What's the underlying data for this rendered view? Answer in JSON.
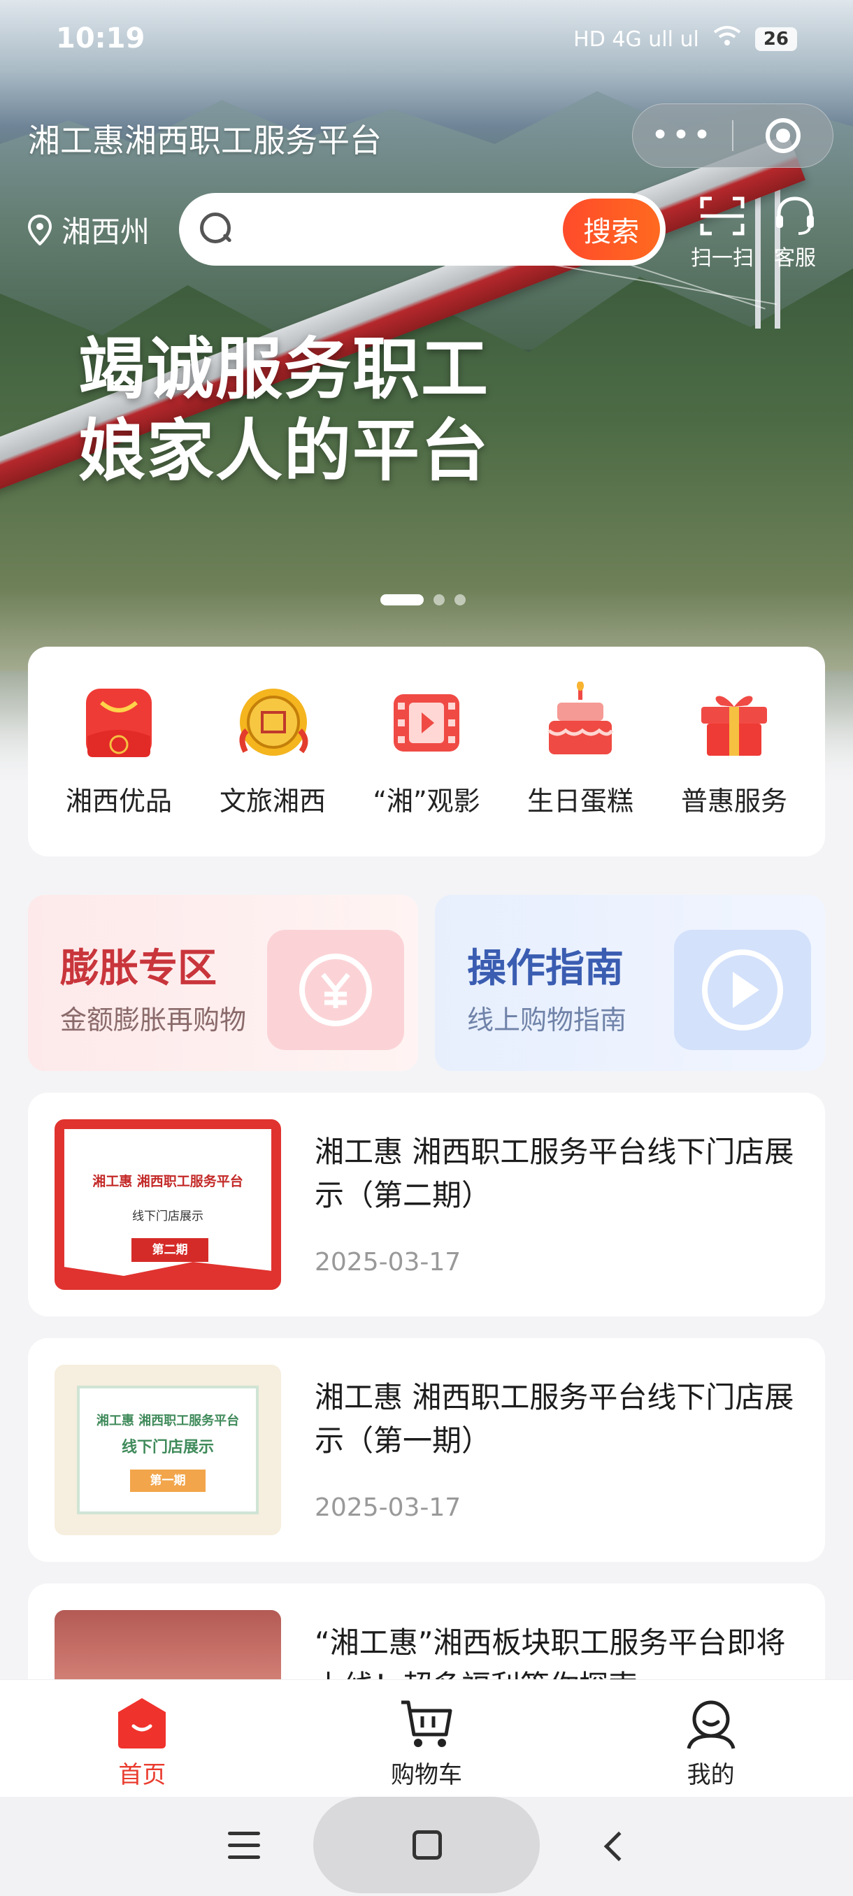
{
  "status_bar": {
    "time": "10:19",
    "signal_text": "HD 4G ull ul",
    "battery": "26"
  },
  "header": {
    "title": "湘工惠湘西职工服务平台",
    "menu_dots": "•••",
    "location": "湘西州",
    "search_placeholder": "",
    "search_button": "搜索",
    "scan_label": "扫一扫",
    "service_label": "客服"
  },
  "banner": {
    "line1": "竭诚服务职工",
    "line2": "娘家人的平台",
    "active_slide": 1,
    "slide_count": 3
  },
  "quick_menu": [
    {
      "label": "湘西优品",
      "icon": "red-bag-icon"
    },
    {
      "label": "文旅湘西",
      "icon": "gold-seal-icon"
    },
    {
      "label": "“湘”观影",
      "icon": "film-icon"
    },
    {
      "label": "生日蛋糕",
      "icon": "cake-icon"
    },
    {
      "label": "普惠服务",
      "icon": "gift-icon"
    }
  ],
  "promos": [
    {
      "title": "膨胀专区",
      "subtitle": "金额膨胀再购物",
      "icon": "yen-cycle-icon"
    },
    {
      "title": "操作指南",
      "subtitle": "线上购物指南",
      "icon": "play-icon"
    }
  ],
  "news": [
    {
      "title": "湘工惠 湘西职工服务平台线下门店展示（第二期）",
      "date": "2025-03-17",
      "thumb_main": "湘工惠 湘西职工服务平台",
      "thumb_sub": "线下门店展示",
      "thumb_tag": "第二期"
    },
    {
      "title": "湘工惠 湘西职工服务平台线下门店展示（第一期）",
      "date": "2025-03-17",
      "thumb_main": "湘工惠 湘西职工服务平台",
      "thumb_sub": "线下门店展示",
      "thumb_tag": "第一期"
    },
    {
      "title": "“湘工惠”湘西板块职工服务平台即将上线！超多福利等你探索",
      "date": ""
    }
  ],
  "tabbar": [
    {
      "label": "首页",
      "icon": "home-icon",
      "active": true
    },
    {
      "label": "购物车",
      "icon": "cart-icon",
      "active": false
    },
    {
      "label": "我的",
      "icon": "user-icon",
      "active": false
    }
  ],
  "colors": {
    "accent": "#e93b2e",
    "search_button": "#ff5a24",
    "promo_red": "#c8353b",
    "promo_blue": "#3a5db1"
  }
}
